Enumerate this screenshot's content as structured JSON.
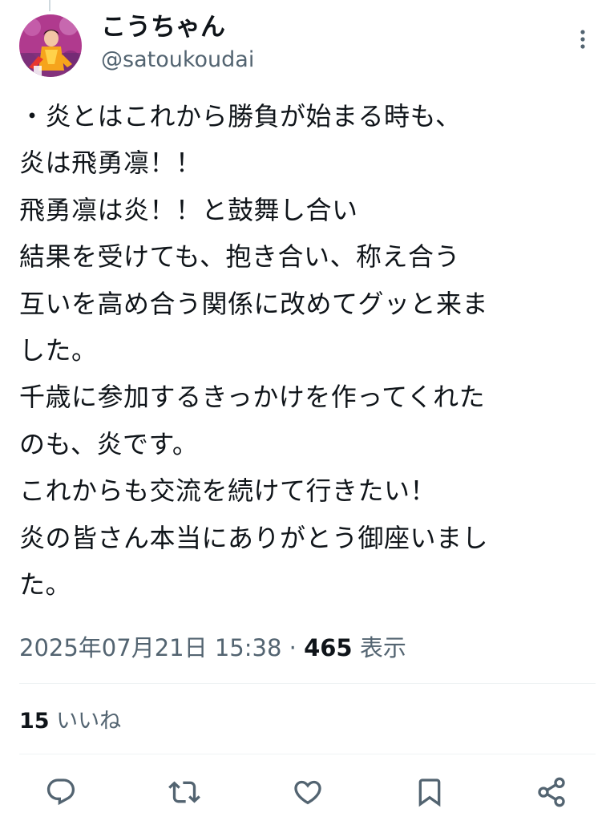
{
  "user": {
    "display_name": "こうちゃん",
    "handle": "@satoukoudai"
  },
  "tweet": {
    "lines": [
      "・炎とはこれから勝負が始まる時も、",
      "炎は飛勇凛！！",
      "飛勇凛は炎！！と鼓舞し合い",
      "結果を受けても、抱き合い、称え合う",
      "互いを高め合う関係に改めてグッと来ま",
      "した。",
      "千歳に参加するきっかけを作ってくれた",
      "のも、炎です。",
      "これからも交流を続けて行きたい！",
      "炎の皆さん本当にありがとう御座いまし",
      "た。"
    ]
  },
  "meta": {
    "timestamp": "2025年07月21日 15:38",
    "separator": " · ",
    "views_count": "465",
    "views_label": " 表示"
  },
  "stats": {
    "likes_count": "15",
    "likes_label": " いいね"
  },
  "actions": {
    "reply_icon": "reply-icon",
    "retweet_icon": "retweet-icon",
    "like_icon": "heart-icon",
    "bookmark_icon": "bookmark-icon",
    "share_icon": "share-icon"
  },
  "colors": {
    "text_primary": "#0f1419",
    "text_secondary": "#536471",
    "divider": "#eff3f4"
  }
}
